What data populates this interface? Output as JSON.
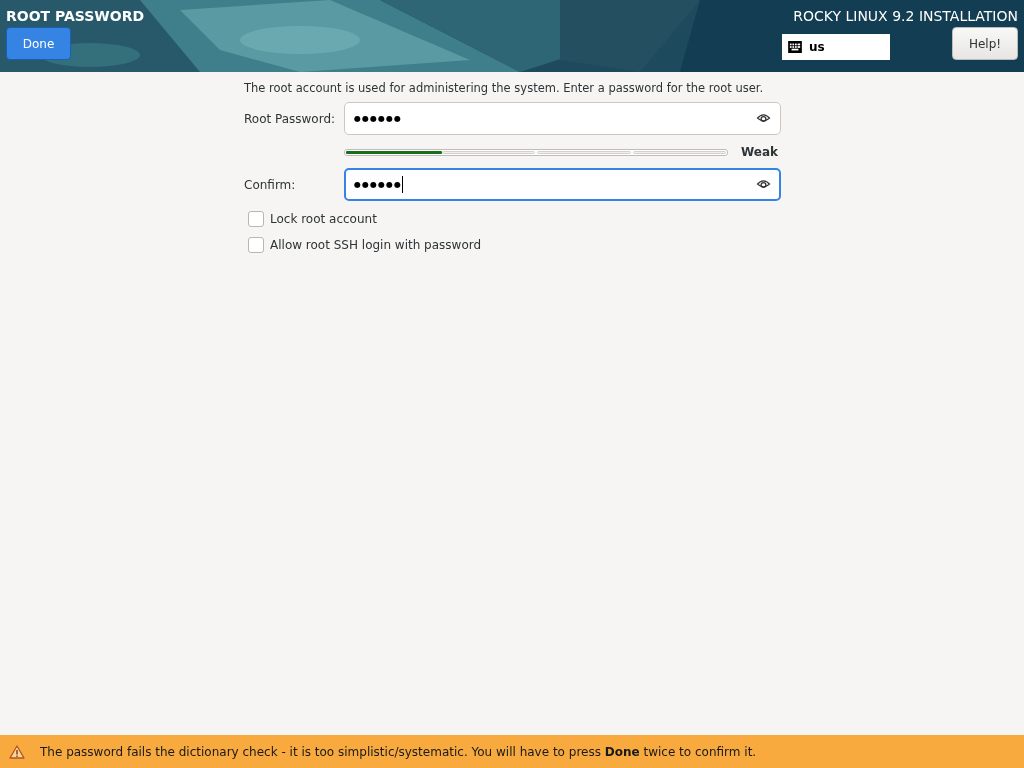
{
  "header": {
    "title": "ROOT PASSWORD",
    "done_button": "Done",
    "product": "ROCKY LINUX 9.2 INSTALLATION",
    "keyboard_layout": "us",
    "help_button": "Help!"
  },
  "intro": "The root account is used for administering the system.  Enter a password for the root user.",
  "fields": [
    {
      "kind": "password",
      "label": "Root Password:",
      "value": "●●●●●●",
      "focused": false
    },
    {
      "kind": "strength",
      "level": 0.25,
      "reading": "Weak"
    },
    {
      "kind": "password",
      "label": "Confirm:",
      "value": "●●●●●●",
      "focused": true
    }
  ],
  "checkboxes": [
    {
      "label": "Lock root account",
      "checked": false
    },
    {
      "label": "Allow root SSH login with password",
      "checked": false
    }
  ],
  "status_bar": {
    "message": "The password fails the dictionary check - it is too simplistic/systematic. You will have to press **Done** twice to confirm it."
  }
}
